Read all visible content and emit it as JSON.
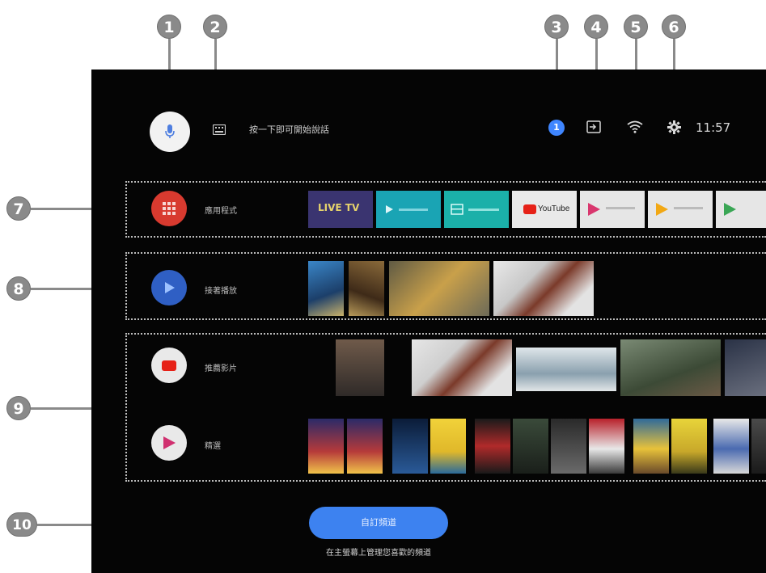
{
  "callouts": [
    "1",
    "2",
    "3",
    "4",
    "5",
    "6",
    "7",
    "8",
    "9",
    "10"
  ],
  "header": {
    "search_hint": "按一下即可開始說話",
    "notification_count": "1",
    "time": "11:57"
  },
  "rows": {
    "favorites": {
      "label": "應用程式",
      "apps": [
        "LIVE TV",
        "",
        "",
        "YouTube",
        "",
        "",
        ""
      ]
    },
    "play_next": {
      "label": "接著播放"
    },
    "youtube": {
      "label": "推薦影片"
    },
    "movies": {
      "label": "精選"
    }
  },
  "cta": {
    "label": "自訂頻道",
    "subtitle": "在主螢幕上管理您喜歡的頻道"
  },
  "colors": {
    "accent": "#3d82f0",
    "screen_bg": "#050505",
    "callout": "#8a8a8a"
  },
  "icons": {
    "mic": "microphone-icon",
    "keyboard": "keyboard-icon",
    "input": "input-source-icon",
    "wifi": "wifi-icon",
    "settings": "gear-icon"
  }
}
